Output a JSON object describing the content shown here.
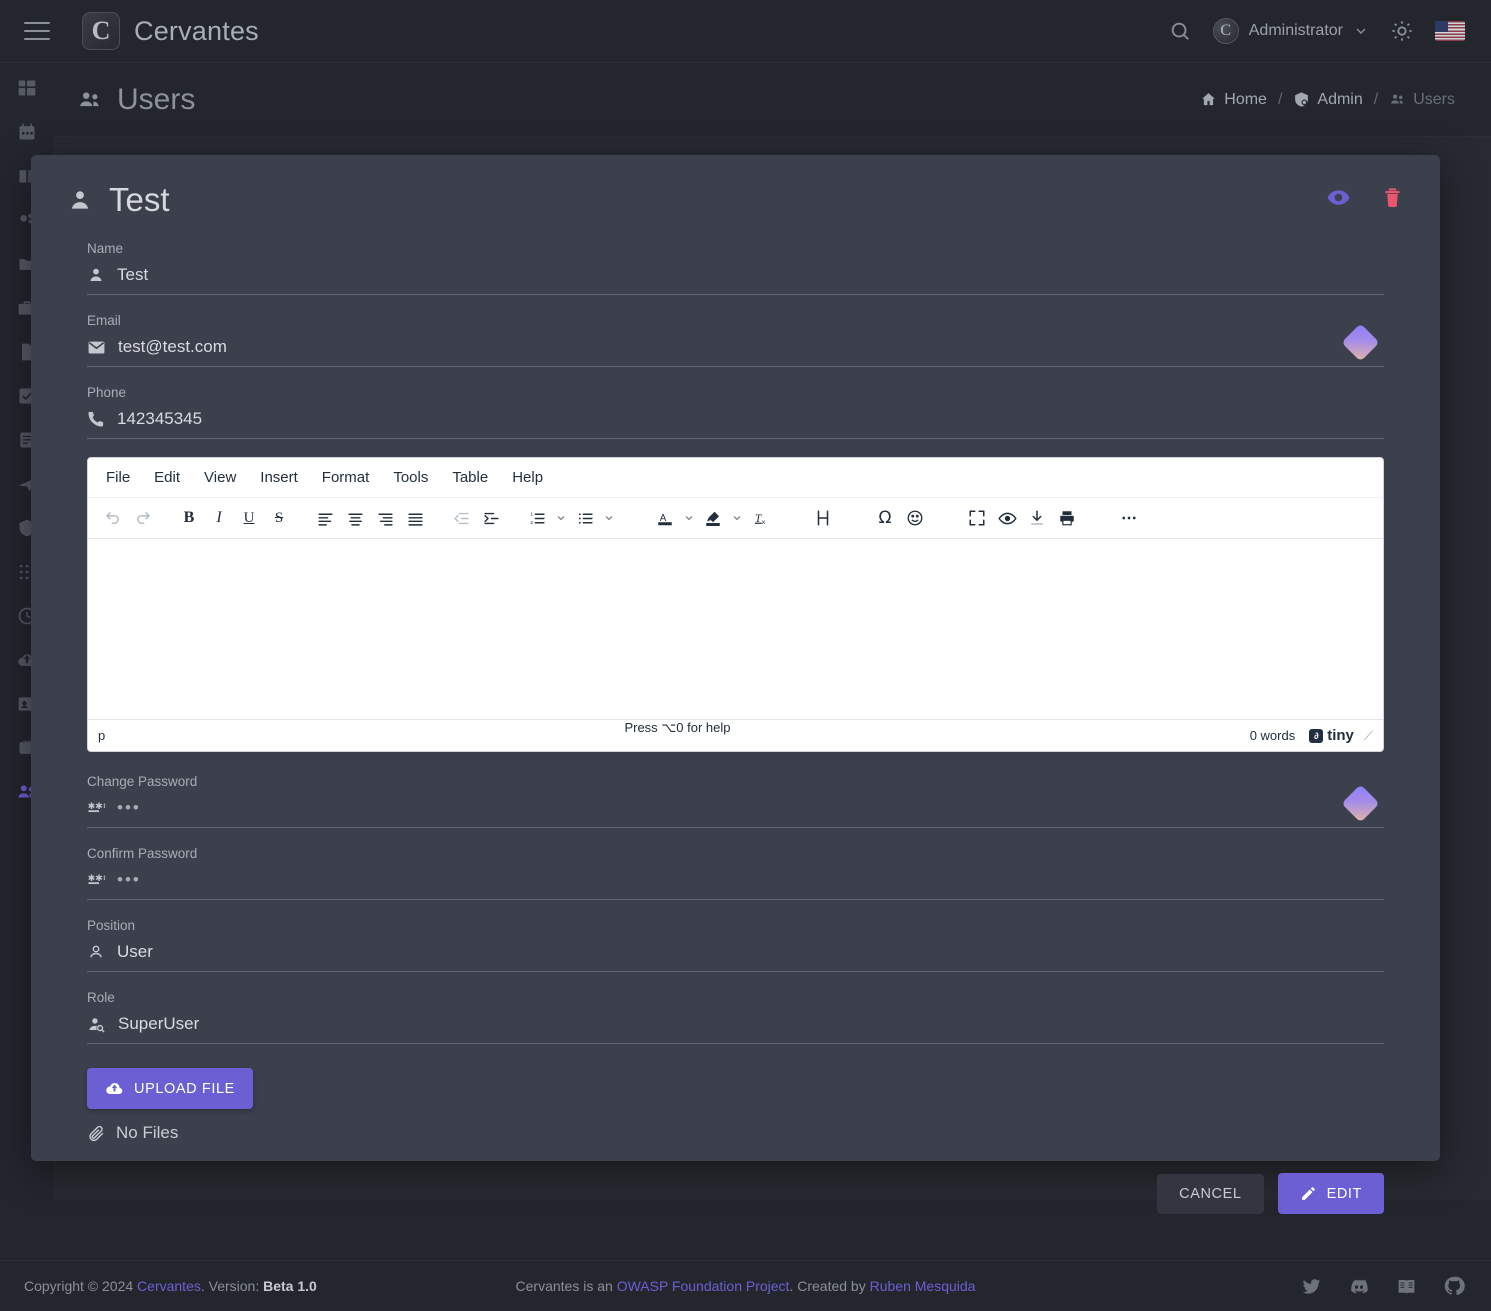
{
  "topbar": {
    "menu_icon": "hamburger-icon",
    "brand": "Cervantes",
    "brand_mark": "C",
    "search_icon": "search-icon",
    "user": "Administrator",
    "user_avatar_letter": "C",
    "chevron_icon": "chevron-down-icon",
    "theme_icon": "sun-icon",
    "language_flag": "us-flag-icon"
  },
  "sidebar": {
    "items": [
      {
        "name": "dashboard",
        "icon": "dashboard-icon",
        "active": false
      },
      {
        "name": "calendar",
        "icon": "calendar-icon",
        "active": false
      },
      {
        "name": "documents",
        "icon": "book-icon",
        "active": false
      },
      {
        "name": "vulnerabilities",
        "icon": "bug-icon",
        "active": false
      },
      {
        "name": "projects",
        "icon": "folder-icon",
        "active": false
      },
      {
        "name": "clients",
        "icon": "briefcase-icon",
        "active": false
      },
      {
        "name": "reports",
        "icon": "file-icon",
        "active": false
      },
      {
        "name": "tasks",
        "icon": "task-check-icon",
        "active": false
      },
      {
        "name": "notes",
        "icon": "notes-icon",
        "active": false
      },
      {
        "name": "targets",
        "icon": "target-icon",
        "active": false
      },
      {
        "name": "shield",
        "icon": "shield-icon",
        "active": false
      },
      {
        "name": "apps",
        "icon": "grid-dots-icon",
        "active": false
      },
      {
        "name": "history",
        "icon": "clock-icon",
        "active": false
      },
      {
        "name": "upload",
        "icon": "cloud-upload-icon",
        "active": false
      },
      {
        "name": "contacts",
        "icon": "id-card-icon",
        "active": false
      },
      {
        "name": "archive",
        "icon": "archive-icon",
        "active": false
      },
      {
        "name": "users",
        "icon": "users-icon",
        "active": true
      }
    ]
  },
  "page": {
    "title": "Users",
    "title_icon": "users-icon",
    "breadcrumb": [
      {
        "label": "Home",
        "icon": "home-icon",
        "muted": false
      },
      {
        "label": "Admin",
        "icon": "shield-admin-icon",
        "muted": false
      },
      {
        "label": "Users",
        "icon": "users-icon",
        "muted": true
      }
    ],
    "breadcrumb_separator": "/"
  },
  "modal": {
    "title": "Test",
    "title_icon": "person-icon",
    "actions": {
      "view_icon": "eye-icon",
      "view_color": "#6c5fd4",
      "delete_icon": "trash-icon",
      "delete_color": "#e8556e"
    },
    "fields": [
      {
        "label": "Name",
        "value": "Test",
        "icon": "person-icon",
        "password_manager": false
      },
      {
        "label": "Email",
        "value": "test@test.com",
        "icon": "email-icon",
        "password_manager": true
      },
      {
        "label": "Phone",
        "value": "142345345",
        "icon": "phone-icon",
        "password_manager": false
      }
    ],
    "password_fields": [
      {
        "label": "Change Password",
        "value": "•••",
        "icon": "password-icon",
        "password_manager": true
      },
      {
        "label": "Confirm Password",
        "value": "•••",
        "icon": "password-icon",
        "password_manager": false
      }
    ],
    "role_fields": [
      {
        "label": "Position",
        "value": "User",
        "icon": "person-outline-icon"
      },
      {
        "label": "Role",
        "value": "SuperUser",
        "icon": "person-search-icon"
      }
    ],
    "editor": {
      "menus": [
        "File",
        "Edit",
        "View",
        "Insert",
        "Format",
        "Tools",
        "Table",
        "Help"
      ],
      "toolbar": [
        {
          "name": "undo",
          "icon": "undo-icon",
          "disabled": true
        },
        {
          "name": "redo",
          "icon": "redo-icon",
          "disabled": true
        },
        {
          "name": "bold",
          "icon": "bold-icon",
          "disabled": false
        },
        {
          "name": "italic",
          "icon": "italic-icon",
          "disabled": false
        },
        {
          "name": "underline",
          "icon": "underline-icon",
          "disabled": false
        },
        {
          "name": "strikethrough",
          "icon": "strikethrough-icon",
          "disabled": false
        },
        {
          "name": "align-left",
          "icon": "align-left-icon",
          "disabled": false
        },
        {
          "name": "align-center",
          "icon": "align-center-icon",
          "disabled": false
        },
        {
          "name": "align-right",
          "icon": "align-right-icon",
          "disabled": false
        },
        {
          "name": "align-justify",
          "icon": "align-justify-icon",
          "disabled": false
        },
        {
          "name": "outdent",
          "icon": "outdent-icon",
          "disabled": true
        },
        {
          "name": "indent",
          "icon": "indent-icon",
          "disabled": false
        },
        {
          "name": "numbered-list",
          "icon": "ordered-list-icon",
          "disabled": false
        },
        {
          "name": "bullet-list",
          "icon": "unordered-list-icon",
          "disabled": false
        },
        {
          "name": "text-color",
          "icon": "text-color-icon",
          "disabled": false
        },
        {
          "name": "highlight-color",
          "icon": "highlight-color-icon",
          "disabled": false
        },
        {
          "name": "clear-formatting",
          "icon": "remove-format-icon",
          "disabled": false
        },
        {
          "name": "page-break",
          "icon": "page-break-icon",
          "disabled": false
        },
        {
          "name": "special-character",
          "icon": "omega-icon",
          "disabled": false
        },
        {
          "name": "emoticons",
          "icon": "smiley-icon",
          "disabled": false
        },
        {
          "name": "fullscreen",
          "icon": "fullscreen-icon",
          "disabled": false
        },
        {
          "name": "preview",
          "icon": "eye-preview-icon",
          "disabled": false
        },
        {
          "name": "export",
          "icon": "download-icon",
          "disabled": false
        },
        {
          "name": "print",
          "icon": "print-icon",
          "disabled": false
        },
        {
          "name": "more",
          "icon": "ellipsis-icon",
          "disabled": false
        }
      ],
      "content": "",
      "status_path": "p",
      "status_help": "Press ⌥0 for help",
      "status_words": "0 words",
      "brand": "tiny",
      "brand_mark": "∂"
    },
    "upload": {
      "button_label": "UPLOAD FILE",
      "button_icon": "cloud-upload-icon",
      "files_label": "No Files",
      "files_icon": "attachment-icon"
    },
    "footer": {
      "cancel_label": "CANCEL",
      "edit_label": "EDIT",
      "edit_icon": "pencil-icon"
    }
  },
  "footer": {
    "copyright_prefix": "Copyright © 2024 ",
    "copyright_link": "Cervantes",
    "version_label": ". Version: ",
    "version_value": "Beta 1.0",
    "center_prefix": "Cervantes is an ",
    "center_link1": "OWASP Foundation Project",
    "center_mid": ". Created by ",
    "center_link2": "Ruben Mesquida",
    "social": [
      {
        "name": "twitter-icon"
      },
      {
        "name": "discord-icon"
      },
      {
        "name": "docs-book-icon"
      },
      {
        "name": "github-icon"
      }
    ]
  },
  "colors": {
    "accent": "#6c5fd4",
    "danger": "#e8556e",
    "page_bg": "#23262d",
    "modal_bg": "#3c3f4c"
  }
}
